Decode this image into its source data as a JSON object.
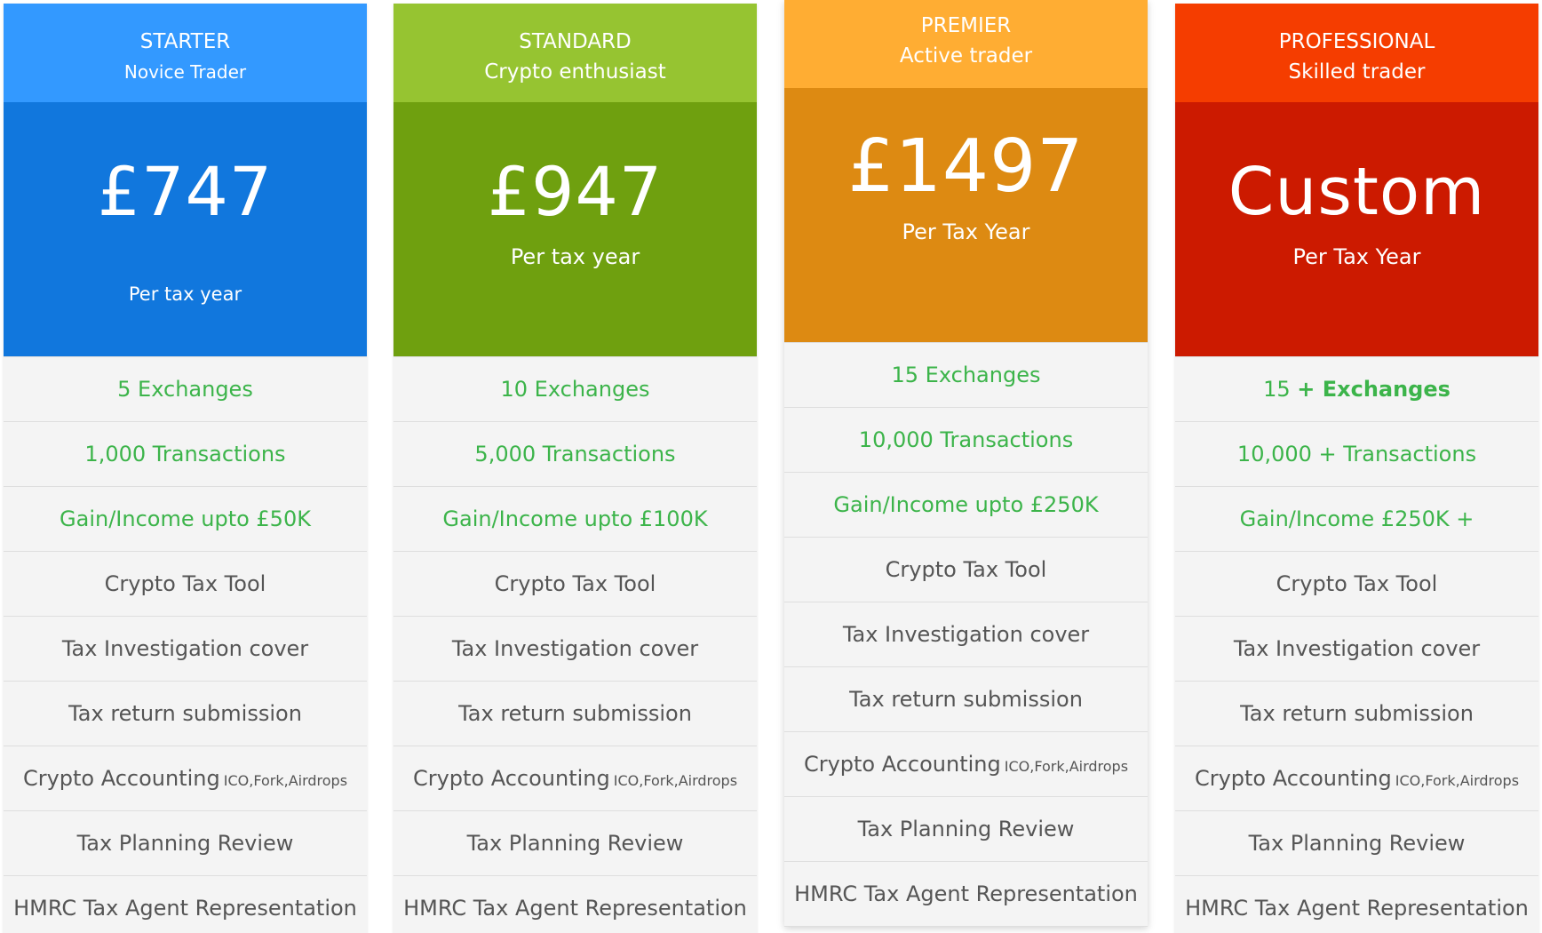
{
  "colors": {
    "starter_head": "#3399ff",
    "starter_price": "#1177dd",
    "standard_head": "#96c431",
    "standard_price": "#6fa00f",
    "premier_head": "#ffad33",
    "premier_price": "#dd8a12",
    "professional_head": "#f53d00",
    "professional_price": "#cc1a00",
    "feature_green": "#3cb44a",
    "feature_text": "#555555",
    "row_bg": "#f4f4f4"
  },
  "plans": [
    {
      "tier": "STARTER",
      "persona": "Novice  Trader",
      "price": "£747",
      "period": "Per tax year",
      "features": {
        "exchanges": "5 Exchanges",
        "transactions": "1,000 Transactions",
        "gain": "Gain/Income upto £50K",
        "tool": "Crypto Tax Tool",
        "investigation": "Tax Investigation cover",
        "submission": "Tax return submission",
        "accounting": "Crypto Accounting",
        "accounting_note": "ICO,Fork,Airdrops",
        "planning": "Tax Planning Review",
        "hmrc": "HMRC Tax Agent Representation"
      }
    },
    {
      "tier": "STANDARD",
      "persona": "Crypto enthusiast",
      "price": "£947",
      "period": "Per tax year",
      "features": {
        "exchanges": "10 Exchanges",
        "transactions": "5,000 Transactions",
        "gain": "Gain/Income upto £100K",
        "tool": "Crypto Tax Tool",
        "investigation": "Tax Investigation cover",
        "submission": "Tax return submission",
        "accounting": "Crypto Accounting",
        "accounting_note": "ICO,Fork,Airdrops",
        "planning": "Tax Planning Review",
        "hmrc": "HMRC Tax Agent Representation"
      }
    },
    {
      "tier": "PREMIER",
      "persona": "Active trader",
      "price": "£1497",
      "period": "Per Tax Year",
      "features": {
        "exchanges": "15 Exchanges",
        "transactions": "10,000 Transactions",
        "gain": "Gain/Income upto £250K",
        "tool": "Crypto Tax Tool",
        "investigation": "Tax Investigation cover",
        "submission": "Tax return submission",
        "accounting": "Crypto Accounting",
        "accounting_note": "ICO,Fork,Airdrops",
        "planning": "Tax Planning Review",
        "hmrc": "HMRC Tax Agent Representation"
      }
    },
    {
      "tier": "PROFESSIONAL",
      "persona": "Skilled trader",
      "price": "Custom",
      "period": "Per Tax Year",
      "features": {
        "exchanges_prefix": "15",
        "exchanges_strong": "+ Exchanges",
        "transactions": "10,000 + Transactions",
        "gain": "Gain/Income £250K +",
        "tool": "Crypto Tax Tool",
        "investigation": "Tax Investigation cover",
        "submission": "Tax return submission",
        "accounting": "Crypto Accounting",
        "accounting_note": "ICO,Fork,Airdrops",
        "planning": "Tax Planning Review",
        "hmrc": "HMRC Tax Agent Representation"
      }
    }
  ]
}
